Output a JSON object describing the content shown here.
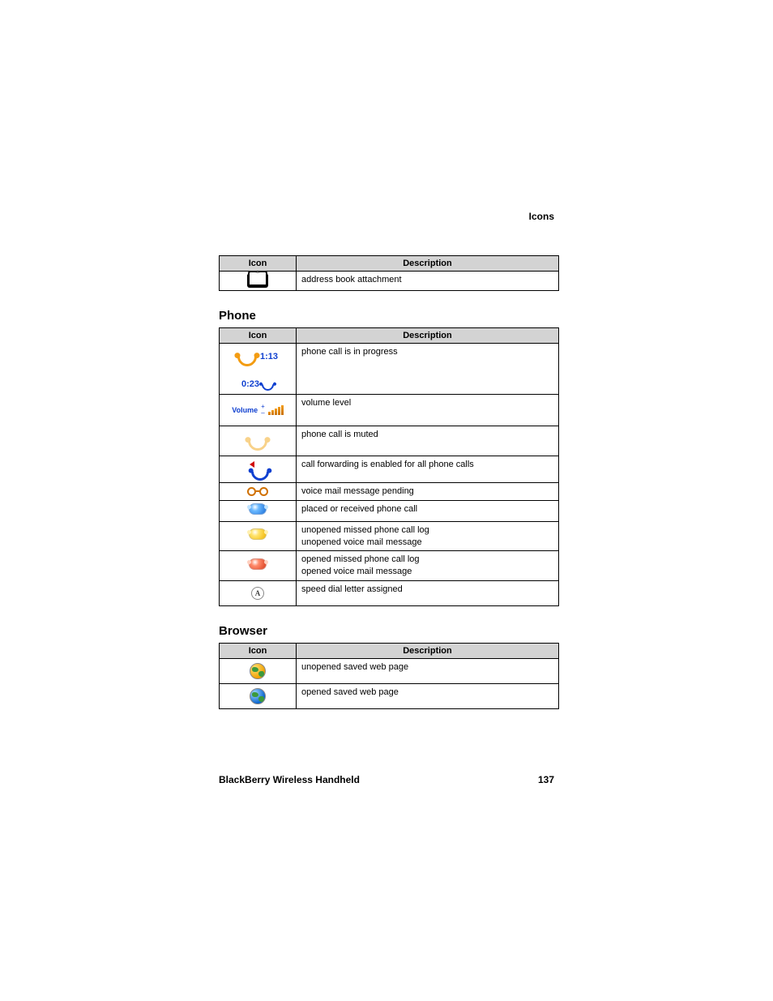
{
  "header": {
    "section_title": "Icons"
  },
  "table_common": {
    "col_icon": "Icon",
    "col_desc": "Description"
  },
  "attachments_table": {
    "rows": [
      {
        "icon": "address-book-icon",
        "desc": "address book attachment"
      }
    ]
  },
  "phone_section": {
    "heading": "Phone",
    "rows": [
      {
        "icon": "call-in-progress-icon",
        "aux_text": "1:13",
        "desc": "phone call is in progress"
      },
      {
        "icon": "call-timer-icon",
        "aux_text": "0:23",
        "desc": ""
      },
      {
        "icon": "volume-level-icon",
        "aux_label": "Volume",
        "aux_plus": "+",
        "aux_minus": "–",
        "desc": "volume level"
      },
      {
        "icon": "call-muted-icon",
        "desc": "phone call is muted"
      },
      {
        "icon": "call-forwarding-icon",
        "desc": "call forwarding is enabled for all phone calls"
      },
      {
        "icon": "voicemail-pending-icon",
        "desc": "voice mail message pending"
      },
      {
        "icon": "placed-received-call-icon",
        "desc": "placed or received phone call"
      },
      {
        "icon": "unopened-missed-call-icon",
        "desc_line1": "unopened missed phone call log",
        "desc_line2": "unopened voice mail message"
      },
      {
        "icon": "opened-missed-call-icon",
        "desc_line1": "opened missed phone call log",
        "desc_line2": "opened voice mail message"
      },
      {
        "icon": "speed-dial-icon",
        "aux_letter": "A",
        "desc": "speed dial letter assigned"
      }
    ]
  },
  "browser_section": {
    "heading": "Browser",
    "rows": [
      {
        "icon": "unopened-saved-page-icon",
        "desc": "unopened saved web page"
      },
      {
        "icon": "opened-saved-page-icon",
        "desc": "opened saved web page"
      }
    ]
  },
  "footer": {
    "product": "BlackBerry Wireless Handheld",
    "page": "137"
  }
}
